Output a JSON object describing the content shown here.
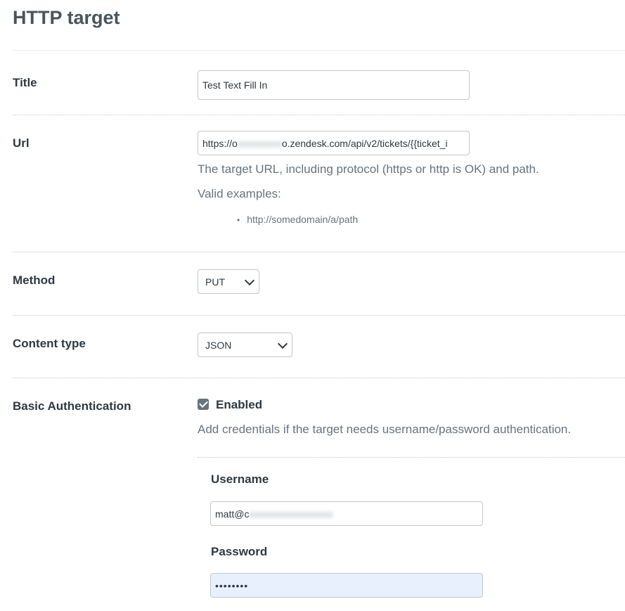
{
  "page": {
    "title": "HTTP target"
  },
  "title_row": {
    "label": "Title",
    "value": "Test Text Fill In"
  },
  "url_row": {
    "label": "Url",
    "value_prefix": "https://o",
    "value_suffix": "o.zendesk.com/api/v2/tickets/{{ticket_i",
    "hint": "The target URL, including protocol (https or http is OK) and path.",
    "examples_heading": "Valid examples:",
    "examples": [
      "http://somedomain/a/path"
    ]
  },
  "method_row": {
    "label": "Method",
    "selected": "PUT"
  },
  "content_type_row": {
    "label": "Content type",
    "selected": "JSON"
  },
  "auth_row": {
    "label": "Basic Authentication",
    "enabled_label": "Enabled",
    "enabled": true,
    "hint": "Add credentials if the target needs username/password authentication.",
    "username_label": "Username",
    "username_prefix": "matt@c",
    "password_label": "Password",
    "password_value": "••••••••"
  }
}
